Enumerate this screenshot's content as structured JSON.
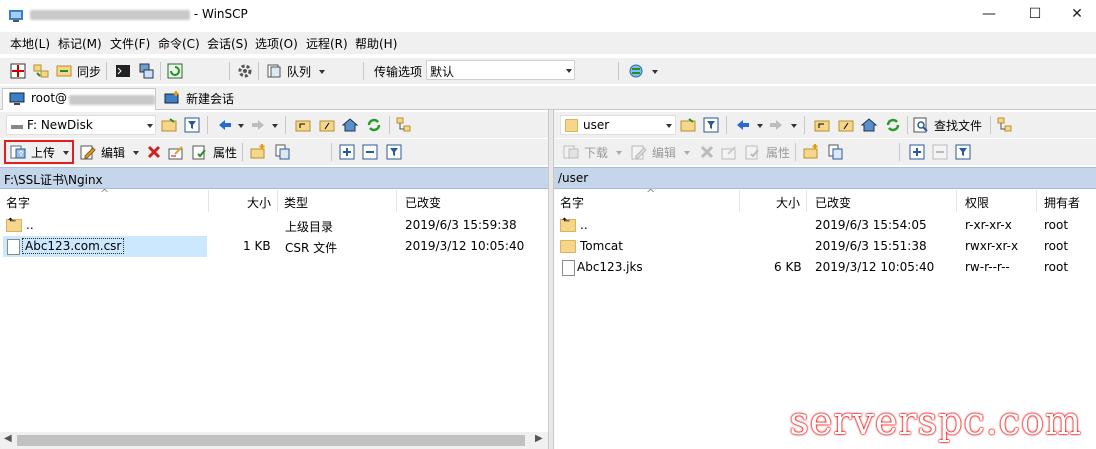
{
  "window": {
    "title": "- WinSCP",
    "minimize_glyph": "—",
    "maximize_glyph": "☐",
    "close_glyph": "✕"
  },
  "menu": [
    "本地(L)",
    "标记(M)",
    "文件(F)",
    "命令(C)",
    "会话(S)",
    "选项(O)",
    "远程(R)",
    "帮助(H)"
  ],
  "toolbar": {
    "sync_label": "同步",
    "queue_label": "队列",
    "transfer_options_label": "传输选项",
    "transfer_preset": "默认"
  },
  "tabs": {
    "session_label": "root@",
    "new_session_label": "新建会话"
  },
  "left": {
    "drive": "F: NewDisk",
    "upload_label": "上传",
    "edit_label": "编辑",
    "properties_label": "属性",
    "path": "F:\\SSL证书\\Nginx",
    "headers": {
      "name": "名字",
      "size": "大小",
      "type": "类型",
      "changed": "已改变"
    },
    "rows": [
      {
        "name": "..",
        "size": "",
        "type": "上级目录",
        "changed": "2019/6/3  15:59:38",
        "icon": "updir-icon"
      },
      {
        "name": "Abc123.com.csr",
        "size": "1 KB",
        "type": "CSR 文件",
        "changed": "2019/3/12  10:05:40",
        "icon": "file-icon"
      }
    ]
  },
  "right": {
    "folder": "user",
    "find_files_label": "查找文件",
    "download_label": "下载",
    "edit_label": "编辑",
    "properties_label": "属性",
    "path": "/user",
    "headers": {
      "name": "名字",
      "size": "大小",
      "changed": "已改变",
      "rights": "权限",
      "owner": "拥有者"
    },
    "rows": [
      {
        "name": "..",
        "size": "",
        "changed": "2019/6/3 15:54:05",
        "rights": "r-xr-xr-x",
        "owner": "root",
        "icon": "updir-icon"
      },
      {
        "name": "Tomcat",
        "size": "",
        "changed": "2019/6/3 15:51:38",
        "rights": "rwxr-xr-x",
        "owner": "root",
        "icon": "folder-icon"
      },
      {
        "name": "Abc123.jks",
        "size": "6 KB",
        "changed": "2019/3/12 10:05:40",
        "rights": "rw-r--r--",
        "owner": "root",
        "icon": "file-icon"
      }
    ]
  },
  "watermark": "serverspc.com",
  "colors": {
    "path_bar": "#c5d6ea",
    "selection": "#cce8ff",
    "highlight_box": "#e02020"
  }
}
